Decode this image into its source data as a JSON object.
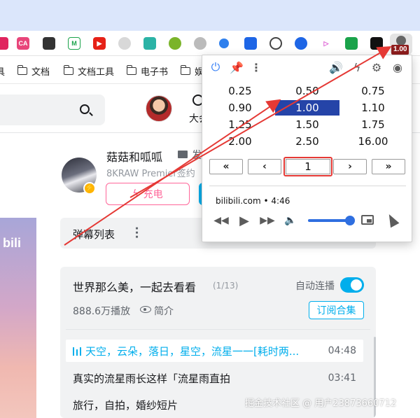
{
  "browser": {
    "extension_badge": "1.00"
  },
  "bookmarks": [
    {
      "label": "具"
    },
    {
      "label": "文档"
    },
    {
      "label": "文档工具"
    },
    {
      "label": "电子书"
    },
    {
      "label": "娱"
    }
  ],
  "header": {
    "big_label": "大会"
  },
  "uploader": {
    "name": "菇菇和呱呱",
    "message_label": "发",
    "description": "8KRAW Premier签约",
    "charge_label": "充电",
    "vip_mark": "⚡"
  },
  "cover": {
    "logo_text": "bili"
  },
  "danmaku": {
    "title": "弹幕列表"
  },
  "playlist": {
    "title": "世界那么美，一起去看看",
    "count": "(1/13)",
    "autoplay_label": "自动连播",
    "views": "888.6万播放",
    "intro_label": "简介",
    "subscribe_label": "订阅合集",
    "items": [
      {
        "title": "天空，云朵，落日，星空，流星一一[耗时两...",
        "duration": "04:48",
        "active": true
      },
      {
        "title": "真实的流星雨长这样「流星雨直拍",
        "duration": "03:41",
        "active": false
      },
      {
        "title": "旅行，自拍，婚纱短片",
        "duration": "",
        "active": false
      }
    ]
  },
  "popup": {
    "speeds": [
      "0.25",
      "0.50",
      "0.75",
      "0.90",
      "1.00",
      "1.10",
      "1.25",
      "1.50",
      "1.75",
      "2.00",
      "2.50",
      "16.00"
    ],
    "selected_speed": "1.00",
    "nav": {
      "first": "«",
      "prev": "‹",
      "next": "›",
      "last": "»"
    },
    "speed_input_value": "1",
    "source": "bilibili.com • 4:46",
    "volume_level": 0.85
  },
  "watermark": "掘金技术社区 @ 用户23873660712",
  "colors": {
    "accent_blue": "#00aeec",
    "pink": "#ff6699",
    "selected_speed_bg": "#2544a8",
    "annotation_red": "#e53935"
  }
}
